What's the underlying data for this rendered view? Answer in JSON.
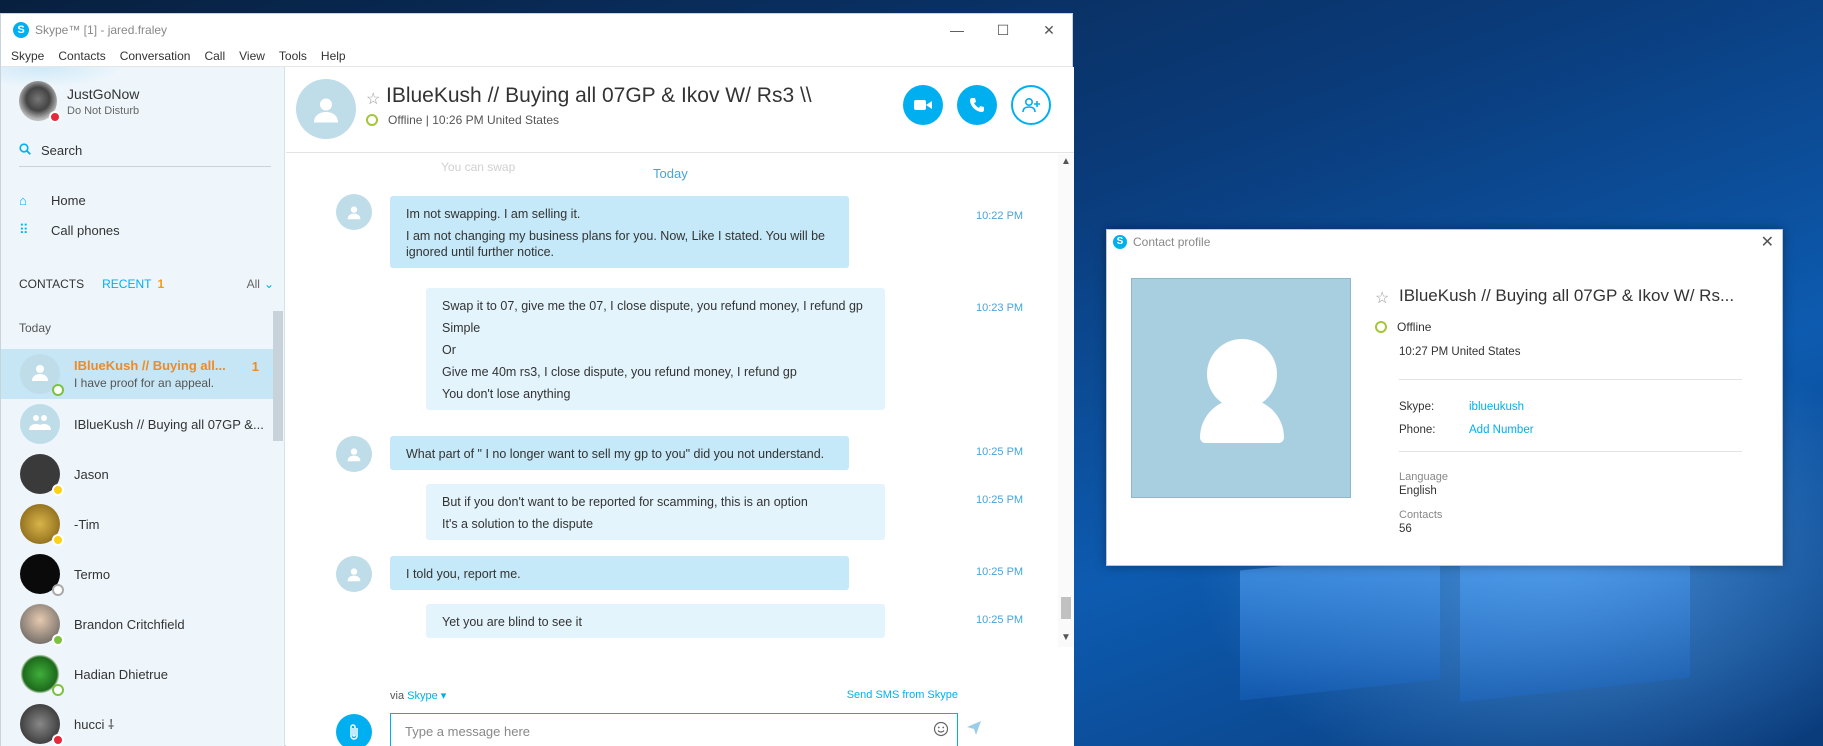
{
  "window": {
    "title": "Skype™ [1] - jared.fraley",
    "logo": "S",
    "minimize": "—",
    "maximize": "☐",
    "close": "✕"
  },
  "menu": [
    "Skype",
    "Contacts",
    "Conversation",
    "Call",
    "View",
    "Tools",
    "Help"
  ],
  "me": {
    "name": "JustGoNow",
    "status": "Do Not Disturb"
  },
  "search": {
    "label": "Search"
  },
  "nav": [
    {
      "label": "Home",
      "icon": "home-icon",
      "glyph": "⌂"
    },
    {
      "label": "Call phones",
      "icon": "dialpad-icon",
      "glyph": "⠿"
    }
  ],
  "tabs": {
    "contacts": "CONTACTS",
    "recent": "RECENT",
    "recent_count": "1",
    "filter": "All",
    "filter_chevron": "⌄"
  },
  "group_today": "Today",
  "contacts": [
    {
      "name": "IBlueKush // Buying all...",
      "message": "I have proof for an appeal.",
      "count": "1",
      "status": "online",
      "avatar_glyph": "👤",
      "active": true
    },
    {
      "name": "IBlueKush // Buying all 07GP &...",
      "message": "",
      "count": "",
      "status": "",
      "avatar_glyph": "👥",
      "active": false
    },
    {
      "name": "Jason",
      "message": "",
      "count": "",
      "status": "away",
      "avatar_glyph": "",
      "active": false
    },
    {
      "name": "-Tim",
      "message": "",
      "count": "",
      "status": "away",
      "avatar_glyph": "",
      "active": false
    },
    {
      "name": "Termo",
      "message": "",
      "count": "",
      "status": "unknown",
      "avatar_glyph": "",
      "active": false
    },
    {
      "name": "Brandon Critchfield",
      "message": "",
      "count": "",
      "status": "online",
      "avatar_glyph": "",
      "active": false
    },
    {
      "name": "Hadian Dhietrue",
      "message": "",
      "count": "",
      "status": "online",
      "avatar_glyph": "",
      "active": false
    },
    {
      "name": "hucci ⸸",
      "message": "",
      "count": "",
      "status": "dnd",
      "avatar_glyph": "",
      "active": false
    }
  ],
  "conversation": {
    "name": "IBlueKush // Buying all 07GP & Ikov W/ Rs3 \\\\",
    "status": "Offline | 10:26 PM United States",
    "star": "☆",
    "ghost_text": "You can swap",
    "day": "Today",
    "messages": [
      {
        "mine": false,
        "lines": [
          "Im not swapping. I am selling it.",
          "I am not changing my business plans for you. Now, Like I stated. You will be ignored until further notice."
        ],
        "time": "10:22 PM"
      },
      {
        "mine": true,
        "lines": [
          "Swap it to 07, give me the 07, I close dispute, you refund money, I refund gp",
          "Simple",
          "Or",
          "Give me 40m rs3, I close dispute, you refund money, I refund gp",
          "You don't lose anything"
        ],
        "time": "10:23 PM"
      },
      {
        "mine": false,
        "lines": [
          "What part of \" I no longer want to sell my gp to you\" did you not understand."
        ],
        "time": "10:25 PM"
      },
      {
        "mine": true,
        "lines": [
          "But if you don't want to be reported for scamming, this is an option",
          "It's a solution to the dispute"
        ],
        "time": "10:25 PM"
      },
      {
        "mine": false,
        "lines": [
          "I told you, report me."
        ],
        "time": "10:25 PM"
      },
      {
        "mine": true,
        "lines": [
          "Yet you are blind to see it"
        ],
        "time": "10:25 PM"
      }
    ],
    "via_label": "via",
    "via_link": "Skype ▾",
    "send_sms": "Send SMS from Skype",
    "input_placeholder": "Type a message here"
  },
  "profile": {
    "window_title": "Contact profile",
    "name": "IBlueKush // Buying all 07GP & Ikov W/ Rs...",
    "status": "Offline",
    "local_time": "10:27 PM United States",
    "skype_label": "Skype:",
    "skype_value": "iblueukush",
    "phone_label": "Phone:",
    "phone_value": "Add Number",
    "language_label": "Language",
    "language_value": "English",
    "contacts_label": "Contacts",
    "contacts_value": "56"
  },
  "colors": {
    "accent": "#00aff0",
    "recent_badge": "#f08a24",
    "dnd": "#e8283b",
    "online": "#7cc242",
    "away": "#fcd116"
  }
}
